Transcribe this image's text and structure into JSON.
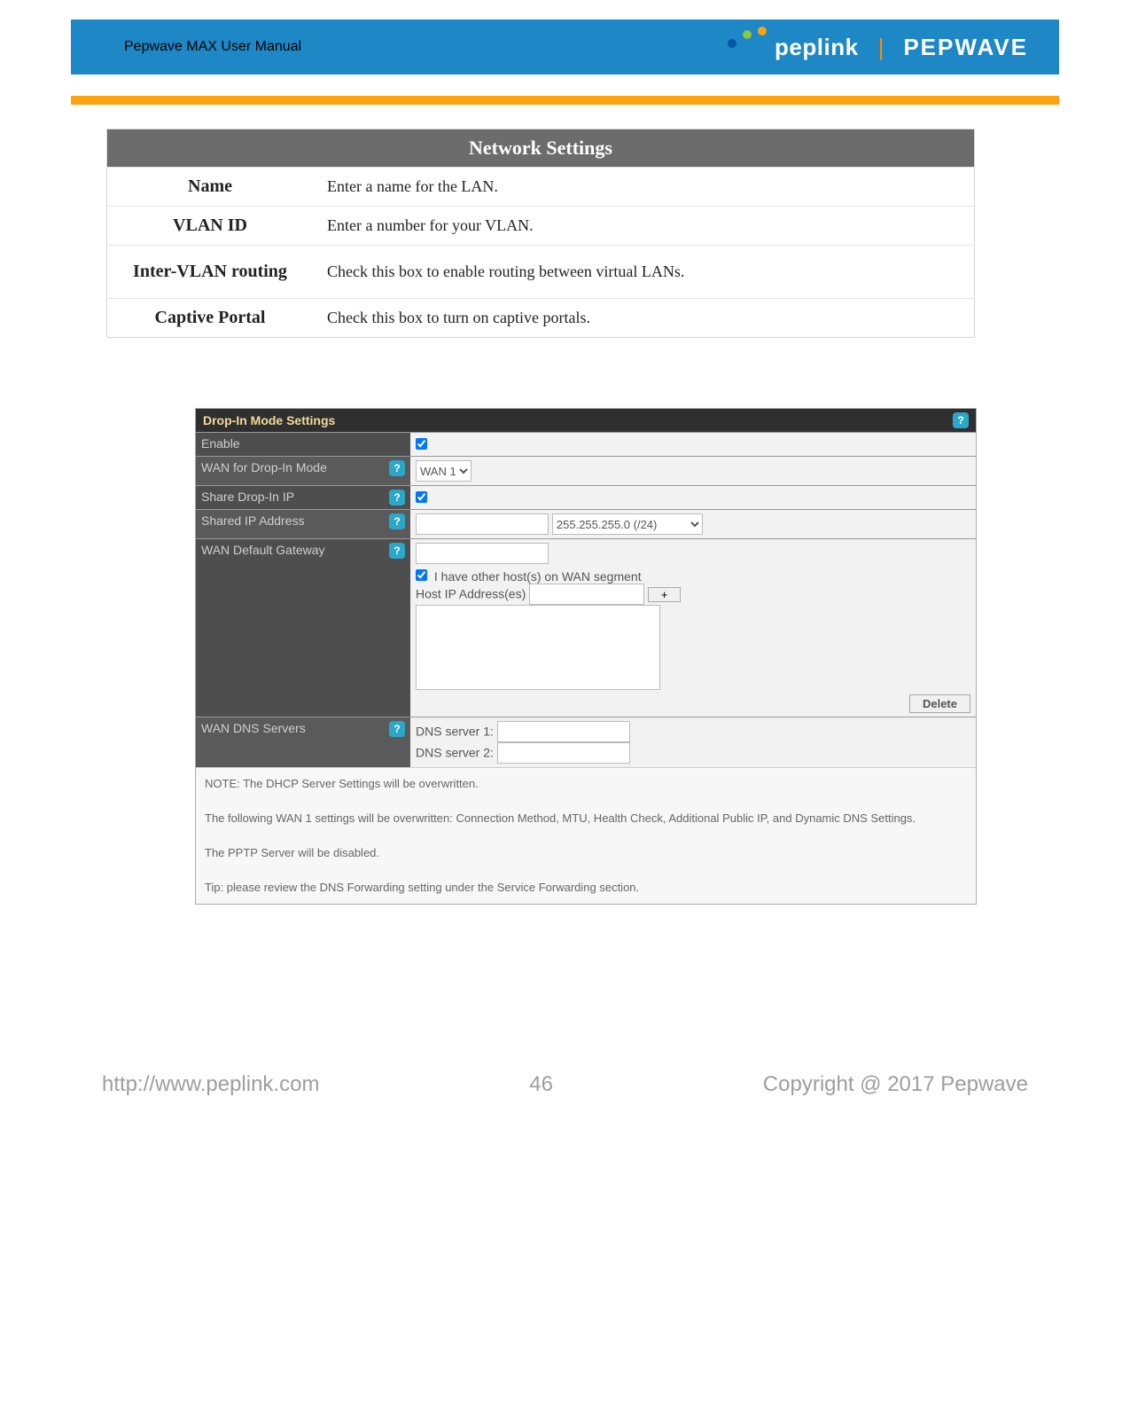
{
  "header": {
    "manual_title": "Pepwave MAX User Manual",
    "logo_left": "peplink",
    "logo_right": "PEPWAVE"
  },
  "network_settings": {
    "title": "Network Settings",
    "rows": {
      "name": {
        "label": "Name",
        "desc": "Enter a name for the LAN."
      },
      "vlan_id": {
        "label": "VLAN ID",
        "desc": "Enter a number for your VLAN."
      },
      "inter_vlan": {
        "label": "Inter-VLAN routing",
        "desc": "Check this box to enable routing between virtual LANs."
      },
      "captive_portal": {
        "label": "Captive Portal",
        "desc": "Check this box to turn on captive portals."
      }
    }
  },
  "dropin": {
    "title": "Drop-In Mode Settings",
    "rows": {
      "enable": {
        "label": "Enable"
      },
      "wan_mode": {
        "label": "WAN for Drop-In Mode",
        "select_value": "WAN 1"
      },
      "share_ip": {
        "label": "Share Drop-In IP"
      },
      "shared_ip_addr": {
        "label": "Shared IP Address",
        "mask_value": "255.255.255.0 (/24)"
      },
      "default_gw": {
        "label": "WAN Default Gateway",
        "other_hosts_label": "I have other host(s) on WAN segment",
        "host_ip_label": "Host IP Address(es)",
        "delete_label": "Delete"
      },
      "dns": {
        "label": "WAN DNS Servers",
        "dns1_label": "DNS server 1:",
        "dns2_label": "DNS server 2:"
      }
    },
    "notes": {
      "line1": "NOTE: The DHCP Server Settings will be overwritten.",
      "line2": "The following WAN 1 settings will be overwritten: Connection Method, MTU, Health Check, Additional Public IP, and Dynamic DNS Settings.",
      "line3": "The PPTP Server will be disabled.",
      "line4": "Tip: please review the DNS Forwarding setting under the Service Forwarding section."
    }
  },
  "footer": {
    "url": "http://www.peplink.com",
    "page": "46",
    "copyright": "Copyright @ 2017 Pepwave"
  }
}
